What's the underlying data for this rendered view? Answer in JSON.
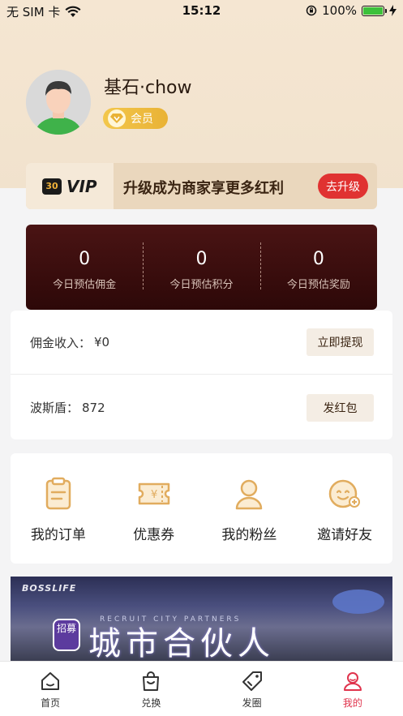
{
  "status_bar": {
    "carrier": "无 SIM 卡",
    "time": "15:12",
    "battery": "100%",
    "battery_level": 1.0
  },
  "profile": {
    "username": "基石·chow",
    "member_badge": "会员"
  },
  "vip_bar": {
    "logo_text": "30",
    "vip_label": "VIP",
    "message": "升级成为商家享更多红利",
    "upgrade_button": "去升级"
  },
  "stats": [
    {
      "value": "0",
      "label": "今日预估佣金"
    },
    {
      "value": "0",
      "label": "今日预估积分"
    },
    {
      "value": "0",
      "label": "今日预估奖励"
    }
  ],
  "wallet": {
    "commission_label": "佣金收入：",
    "commission_value": "¥0",
    "withdraw_button": "立即提现",
    "bosdun_label": "波斯盾：",
    "bosdun_value": "872",
    "red_packet_button": "发红包"
  },
  "menu": [
    {
      "label": "我的订单",
      "icon": "clipboard-icon"
    },
    {
      "label": "优惠券",
      "icon": "coupon-icon"
    },
    {
      "label": "我的粉丝",
      "icon": "person-icon"
    },
    {
      "label": "邀请好友",
      "icon": "smiley-add-icon"
    }
  ],
  "banner": {
    "brand": "BOSSLIFE",
    "subtitle": "RECRUIT CITY PARTNERS",
    "badge": "招募",
    "title": "城市合伙人"
  },
  "tab_bar": [
    {
      "label": "首页",
      "icon": "home-icon"
    },
    {
      "label": "兑换",
      "icon": "bag-icon"
    },
    {
      "label": "发圈",
      "icon": "tag-icon"
    },
    {
      "label": "我的",
      "icon": "user-icon",
      "active": true
    }
  ],
  "colors": {
    "accent_red": "#e03231",
    "active_tab": "#e0334c",
    "gold": "#e9b235",
    "stats_bg": "#3a0e0e"
  }
}
